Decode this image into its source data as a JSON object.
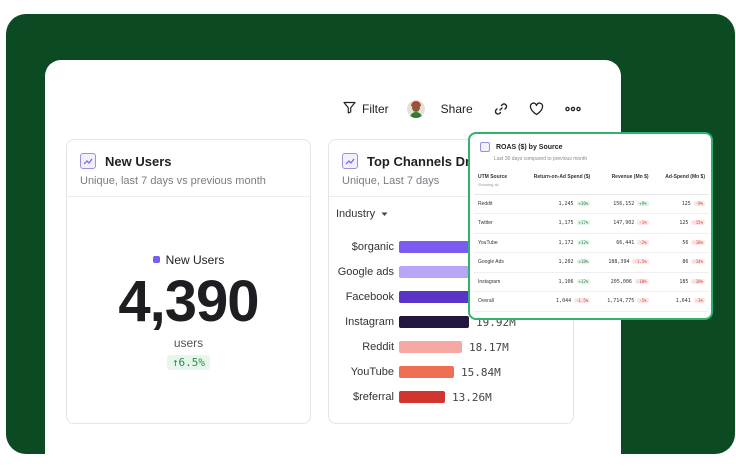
{
  "toolbar": {
    "filter_label": "Filter",
    "share_label": "Share"
  },
  "new_users_card": {
    "title": "New Users",
    "subtitle": "Unique, last 7 days vs previous month",
    "legend_label": "New Users",
    "value": "4,390",
    "unit": "users",
    "delta": "↑6.5%"
  },
  "channels_card": {
    "title": "Top Channels Driv",
    "subtitle": "Unique, Last 7 days",
    "dropdown_label": "Industry",
    "bars": [
      {
        "label": "$organic",
        "value": "",
        "fill": 1.0,
        "color": "#7b5cf0"
      },
      {
        "label": "Google ads",
        "value": "",
        "fill": 1.0,
        "color": "#b7a5f7"
      },
      {
        "label": "Facebook",
        "value": "",
        "fill": 1.0,
        "color": "#5a34c9"
      },
      {
        "label": "Instagram",
        "value": "19.92M",
        "fill": 0.57,
        "color": "#24153f"
      },
      {
        "label": "Reddit",
        "value": "18.17M",
        "fill": 0.52,
        "color": "#f6a9a3"
      },
      {
        "label": "YouTube",
        "value": "15.84M",
        "fill": 0.45,
        "color": "#ef6e52"
      },
      {
        "label": "$referral",
        "value": "13.26M",
        "fill": 0.38,
        "color": "#d2352f"
      }
    ]
  },
  "roas_card": {
    "title": "ROAS ($) by Source",
    "subtitle": "Last 30 days compared to previous month",
    "columns": [
      {
        "label": "UTM Source",
        "sub": "Showing all"
      },
      {
        "label": "Return-on-Ad Spend ($)",
        "sub": ""
      },
      {
        "label": "Revenue (Mn $)",
        "sub": ""
      },
      {
        "label": "Ad-Spend (Mn $)",
        "sub": ""
      }
    ],
    "rows": [
      {
        "source": "Reddit",
        "roas": "1,245",
        "roas_delta": "+30%",
        "revenue": "156,152",
        "revenue_delta": "+9%",
        "spend": "125",
        "spend_delta": "-9%"
      },
      {
        "source": "Twitter",
        "roas": "1,175",
        "roas_delta": "+17%",
        "revenue": "147,902",
        "revenue_delta": "-1%",
        "spend": "125",
        "spend_delta": "-15%"
      },
      {
        "source": "YouTube",
        "roas": "1,172",
        "roas_delta": "+12%",
        "revenue": "66,441",
        "revenue_delta": "-2%",
        "spend": "56",
        "spend_delta": "-18%"
      },
      {
        "source": "Google Ads",
        "roas": "1,202",
        "roas_delta": "+18%",
        "revenue": "188,394",
        "revenue_delta": "-1.5%",
        "spend": "86",
        "spend_delta": "-14%"
      },
      {
        "source": "Instagram",
        "roas": "1,106",
        "roas_delta": "+12%",
        "revenue": "205,006",
        "revenue_delta": "-10%",
        "spend": "185",
        "spend_delta": "-18%"
      },
      {
        "source": "Overall",
        "roas": "1,044",
        "roas_delta": "-1.5%",
        "revenue": "1,714,775",
        "revenue_delta": "-5%",
        "spend": "1,641",
        "spend_delta": "-3%"
      }
    ]
  },
  "colors": {
    "background": "#0c4a24",
    "accent": "#7b5cf0",
    "highlight_border": "#2fb36b"
  }
}
